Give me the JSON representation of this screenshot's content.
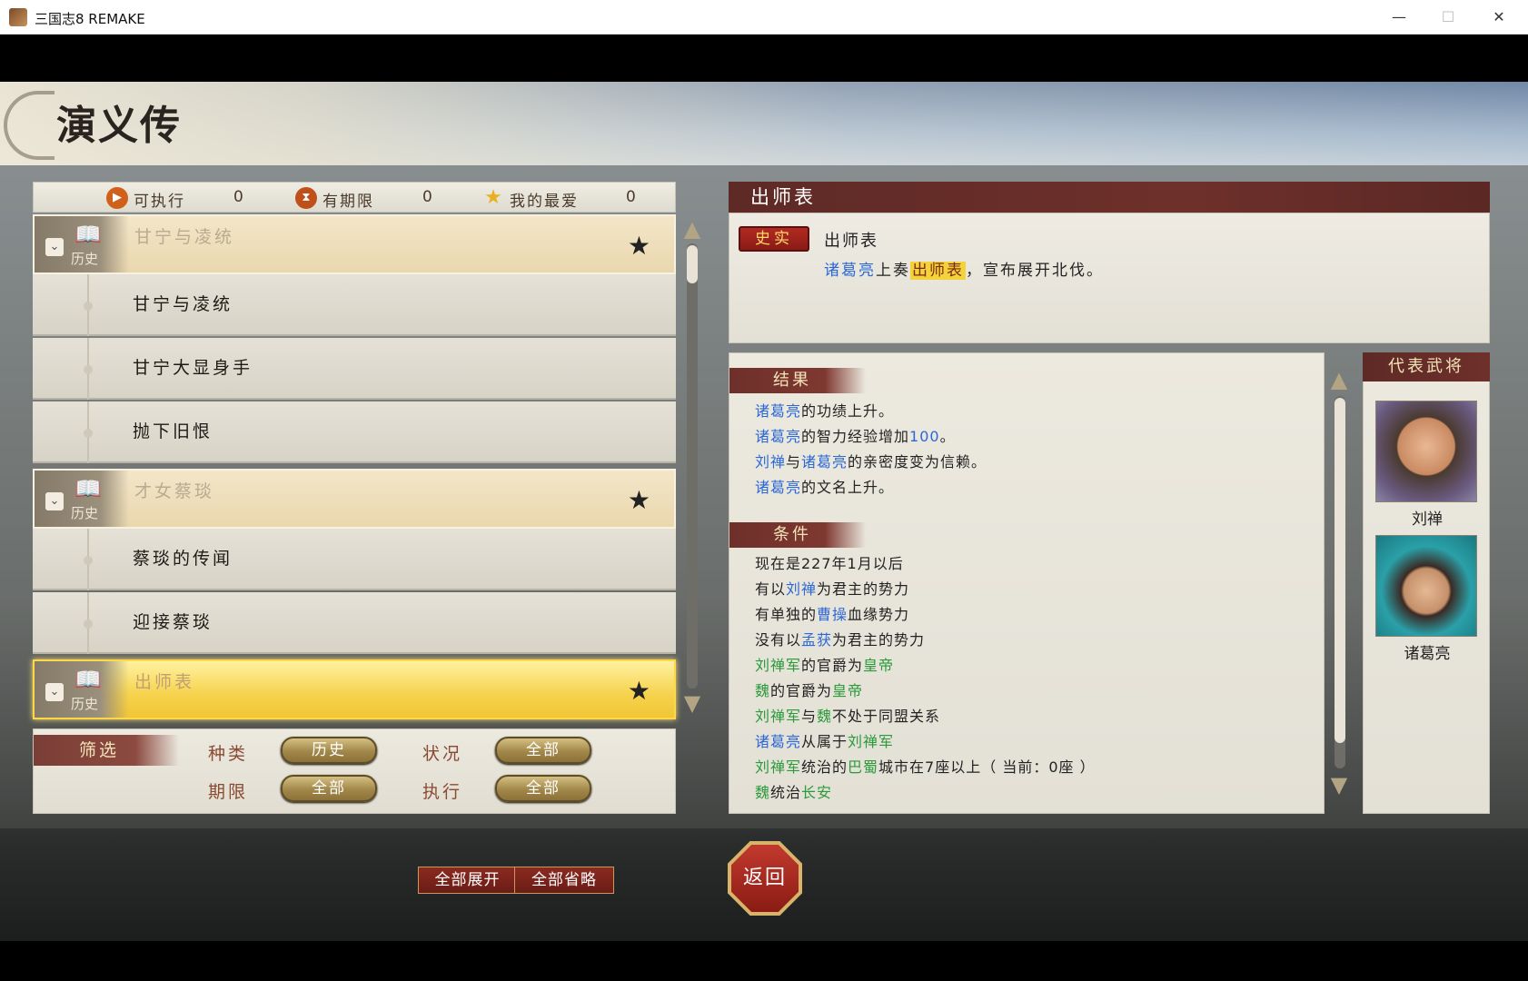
{
  "window": {
    "title": "三国志8 REMAKE",
    "min": "—",
    "max": "☐",
    "close": "✕"
  },
  "page": {
    "title": "演义传"
  },
  "counters": [
    {
      "icon": "▶",
      "label": "可执行",
      "value": "0"
    },
    {
      "icon": "⧗",
      "label": "有期限",
      "value": "0"
    },
    {
      "icon": "★",
      "label": "我的最爱",
      "value": "0"
    }
  ],
  "groups": [
    {
      "title": "甘宁与凌统",
      "type": "历史",
      "items": [
        "甘宁与凌统",
        "甘宁大显身手",
        "抛下旧恨"
      ]
    },
    {
      "title": "才女蔡琰",
      "type": "历史",
      "items": [
        "蔡琰的传闻",
        "迎接蔡琰"
      ]
    },
    {
      "title": "出师表",
      "type": "历史",
      "items": []
    }
  ],
  "filter": {
    "tag": "筛选",
    "kind_label": "种类",
    "kind_value": "历史",
    "status_label": "状况",
    "status_value": "全部",
    "period_label": "期限",
    "period_value": "全部",
    "exec_label": "执行",
    "exec_value": "全部"
  },
  "detail": {
    "header": "出师表",
    "tag": "史实",
    "name": "出师表",
    "desc_a": "诸葛亮",
    "desc_b": "上奏",
    "desc_c": "出师表",
    "desc_d": "，宣布展开北伐。"
  },
  "results": {
    "tag": "结果",
    "lines": [
      [
        {
          "t": "诸葛亮",
          "c": "blue"
        },
        {
          "t": "的功绩上升。"
        }
      ],
      [
        {
          "t": "诸葛亮",
          "c": "blue"
        },
        {
          "t": "的智力经验增加"
        },
        {
          "t": "100",
          "c": "blue"
        },
        {
          "t": "。"
        }
      ],
      [
        {
          "t": "刘禅",
          "c": "blue"
        },
        {
          "t": "与"
        },
        {
          "t": "诸葛亮",
          "c": "blue"
        },
        {
          "t": "的亲密度变为信赖。"
        }
      ],
      [
        {
          "t": "诸葛亮",
          "c": "blue"
        },
        {
          "t": "的文名上升。"
        }
      ]
    ]
  },
  "conditions": {
    "tag": "条件",
    "lines": [
      [
        {
          "t": "现在是227年1月以后"
        }
      ],
      [
        {
          "t": "有以"
        },
        {
          "t": "刘禅",
          "c": "blue"
        },
        {
          "t": "为君主的势力"
        }
      ],
      [
        {
          "t": "有单独的"
        },
        {
          "t": "曹操",
          "c": "blue"
        },
        {
          "t": "血缘势力"
        }
      ],
      [
        {
          "t": "没有以"
        },
        {
          "t": "孟获",
          "c": "blue"
        },
        {
          "t": "为君主的势力"
        }
      ],
      [
        {
          "t": "刘禅军",
          "c": "green"
        },
        {
          "t": "的官爵为"
        },
        {
          "t": "皇帝",
          "c": "green"
        }
      ],
      [
        {
          "t": "魏",
          "c": "green"
        },
        {
          "t": "的官爵为"
        },
        {
          "t": "皇帝",
          "c": "green"
        }
      ],
      [
        {
          "t": "刘禅军",
          "c": "green"
        },
        {
          "t": "与"
        },
        {
          "t": "魏",
          "c": "green"
        },
        {
          "t": "不处于同盟关系"
        }
      ],
      [
        {
          "t": "诸葛亮",
          "c": "blue"
        },
        {
          "t": "从属于"
        },
        {
          "t": "刘禅军",
          "c": "green"
        }
      ],
      [
        {
          "t": "刘禅军",
          "c": "green"
        },
        {
          "t": "统治的"
        },
        {
          "t": "巴蜀",
          "c": "green"
        },
        {
          "t": "城市在7座以上（ 当前：0座 ）"
        }
      ],
      [
        {
          "t": "魏",
          "c": "green"
        },
        {
          "t": "统治"
        },
        {
          "t": "长安",
          "c": "green"
        }
      ]
    ]
  },
  "generals": {
    "header": "代表武将",
    "list": [
      "刘禅",
      "诸葛亮"
    ]
  },
  "bottom": {
    "expand_all": "全部展开",
    "collapse_all": "全部省略",
    "return": "返回"
  },
  "colors": {
    "blue": "#2c68d8",
    "green": "#2a9a3a"
  }
}
